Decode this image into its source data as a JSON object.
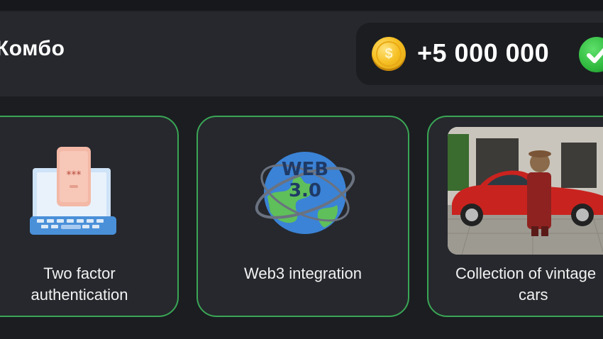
{
  "combo": {
    "title": "Комбо",
    "reward_amount": "+5 000 000",
    "coin_symbol": "$",
    "coin_icon": "coin-icon",
    "status_icon": "checkmark-icon"
  },
  "cards": [
    {
      "title_line1": "Two factor",
      "title_line2": "authentication",
      "icon": "laptop-phone-icon"
    },
    {
      "title_line1": "Web3 integration",
      "title_line2": "",
      "icon": "web3-globe-icon",
      "globe_text_1": "WEB",
      "globe_text_2": "3.0"
    },
    {
      "title_line1": "Collection of vintage",
      "title_line2": "cars",
      "icon": "vintage-car-photo"
    }
  ],
  "colors": {
    "background": "#1b1d21",
    "panel": "#26282d",
    "card_border": "#3aa655",
    "coin": "#f6c024",
    "check": "#2fb93e"
  }
}
